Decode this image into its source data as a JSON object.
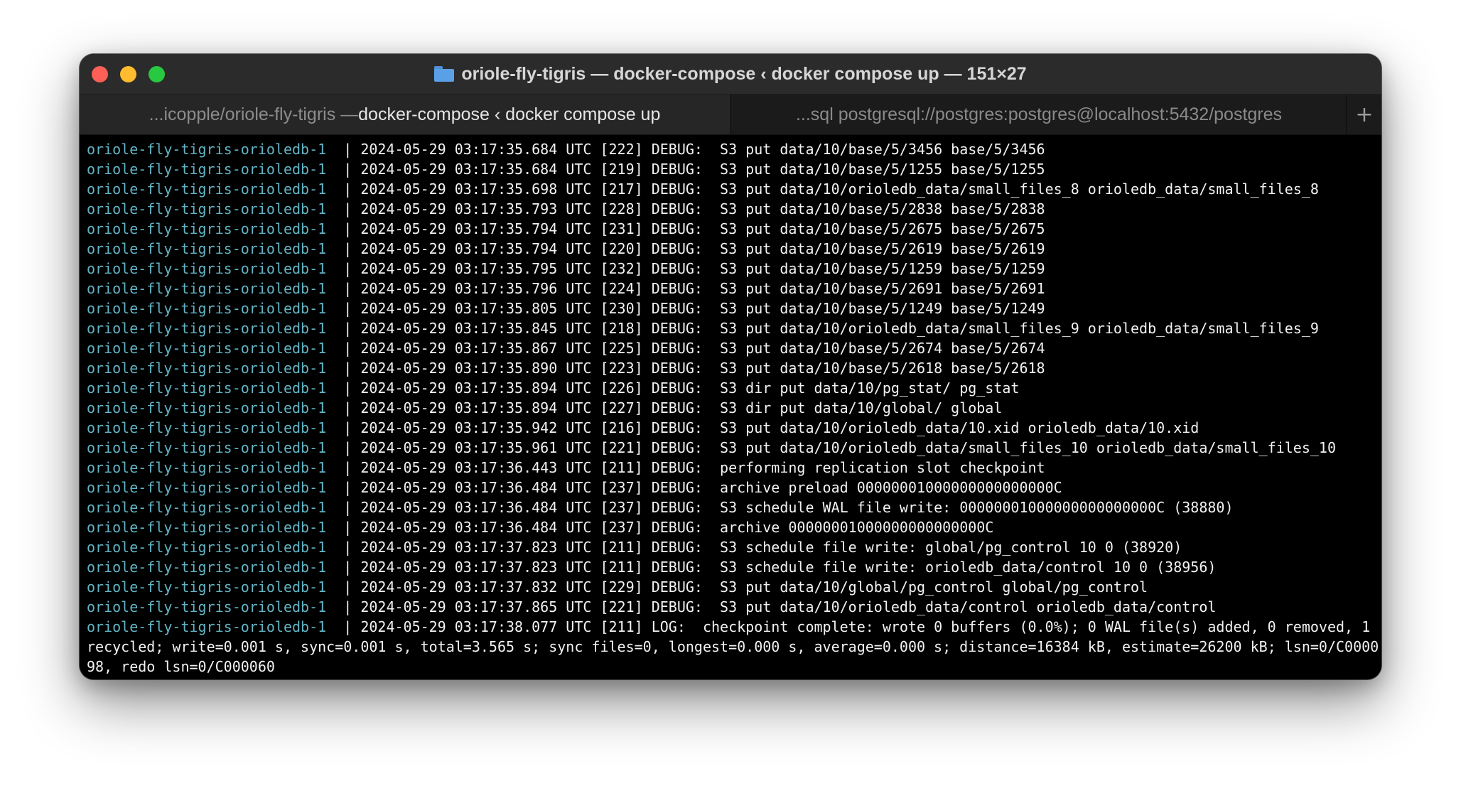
{
  "window": {
    "title": "oriole-fly-tigris — docker-compose ‹ docker compose up — 151×27",
    "title_icon": "folder-icon"
  },
  "tabs": [
    {
      "label_dim": "...icopple/oriole-fly-tigris — ",
      "label_bright": "docker-compose ‹ docker compose up",
      "active": true
    },
    {
      "label_dim": "...sql postgresql://postgres:postgres@localhost:5432/postgres",
      "label_bright": "",
      "active": false
    }
  ],
  "new_tab_label": "+",
  "colors": {
    "service_name": "#62b4c4",
    "log_text": "#f2f2f2",
    "background": "#000000"
  },
  "log_lines": [
    {
      "service": "oriole-fly-tigris-orioledb-1  ",
      "text": "| 2024-05-29 03:17:35.684 UTC [222] DEBUG:  S3 put data/10/base/5/3456 base/5/3456"
    },
    {
      "service": "oriole-fly-tigris-orioledb-1  ",
      "text": "| 2024-05-29 03:17:35.684 UTC [219] DEBUG:  S3 put data/10/base/5/1255 base/5/1255"
    },
    {
      "service": "oriole-fly-tigris-orioledb-1  ",
      "text": "| 2024-05-29 03:17:35.698 UTC [217] DEBUG:  S3 put data/10/orioledb_data/small_files_8 orioledb_data/small_files_8"
    },
    {
      "service": "oriole-fly-tigris-orioledb-1  ",
      "text": "| 2024-05-29 03:17:35.793 UTC [228] DEBUG:  S3 put data/10/base/5/2838 base/5/2838"
    },
    {
      "service": "oriole-fly-tigris-orioledb-1  ",
      "text": "| 2024-05-29 03:17:35.794 UTC [231] DEBUG:  S3 put data/10/base/5/2675 base/5/2675"
    },
    {
      "service": "oriole-fly-tigris-orioledb-1  ",
      "text": "| 2024-05-29 03:17:35.794 UTC [220] DEBUG:  S3 put data/10/base/5/2619 base/5/2619"
    },
    {
      "service": "oriole-fly-tigris-orioledb-1  ",
      "text": "| 2024-05-29 03:17:35.795 UTC [232] DEBUG:  S3 put data/10/base/5/1259 base/5/1259"
    },
    {
      "service": "oriole-fly-tigris-orioledb-1  ",
      "text": "| 2024-05-29 03:17:35.796 UTC [224] DEBUG:  S3 put data/10/base/5/2691 base/5/2691"
    },
    {
      "service": "oriole-fly-tigris-orioledb-1  ",
      "text": "| 2024-05-29 03:17:35.805 UTC [230] DEBUG:  S3 put data/10/base/5/1249 base/5/1249"
    },
    {
      "service": "oriole-fly-tigris-orioledb-1  ",
      "text": "| 2024-05-29 03:17:35.845 UTC [218] DEBUG:  S3 put data/10/orioledb_data/small_files_9 orioledb_data/small_files_9"
    },
    {
      "service": "oriole-fly-tigris-orioledb-1  ",
      "text": "| 2024-05-29 03:17:35.867 UTC [225] DEBUG:  S3 put data/10/base/5/2674 base/5/2674"
    },
    {
      "service": "oriole-fly-tigris-orioledb-1  ",
      "text": "| 2024-05-29 03:17:35.890 UTC [223] DEBUG:  S3 put data/10/base/5/2618 base/5/2618"
    },
    {
      "service": "oriole-fly-tigris-orioledb-1  ",
      "text": "| 2024-05-29 03:17:35.894 UTC [226] DEBUG:  S3 dir put data/10/pg_stat/ pg_stat"
    },
    {
      "service": "oriole-fly-tigris-orioledb-1  ",
      "text": "| 2024-05-29 03:17:35.894 UTC [227] DEBUG:  S3 dir put data/10/global/ global"
    },
    {
      "service": "oriole-fly-tigris-orioledb-1  ",
      "text": "| 2024-05-29 03:17:35.942 UTC [216] DEBUG:  S3 put data/10/orioledb_data/10.xid orioledb_data/10.xid"
    },
    {
      "service": "oriole-fly-tigris-orioledb-1  ",
      "text": "| 2024-05-29 03:17:35.961 UTC [221] DEBUG:  S3 put data/10/orioledb_data/small_files_10 orioledb_data/small_files_10"
    },
    {
      "service": "oriole-fly-tigris-orioledb-1  ",
      "text": "| 2024-05-29 03:17:36.443 UTC [211] DEBUG:  performing replication slot checkpoint"
    },
    {
      "service": "oriole-fly-tigris-orioledb-1  ",
      "text": "| 2024-05-29 03:17:36.484 UTC [237] DEBUG:  archive preload 00000001000000000000000C"
    },
    {
      "service": "oriole-fly-tigris-orioledb-1  ",
      "text": "| 2024-05-29 03:17:36.484 UTC [237] DEBUG:  S3 schedule WAL file write: 00000001000000000000000C (38880)"
    },
    {
      "service": "oriole-fly-tigris-orioledb-1  ",
      "text": "| 2024-05-29 03:17:36.484 UTC [237] DEBUG:  archive 00000001000000000000000C"
    },
    {
      "service": "oriole-fly-tigris-orioledb-1  ",
      "text": "| 2024-05-29 03:17:37.823 UTC [211] DEBUG:  S3 schedule file write: global/pg_control 10 0 (38920)"
    },
    {
      "service": "oriole-fly-tigris-orioledb-1  ",
      "text": "| 2024-05-29 03:17:37.823 UTC [211] DEBUG:  S3 schedule file write: orioledb_data/control 10 0 (38956)"
    },
    {
      "service": "oriole-fly-tigris-orioledb-1  ",
      "text": "| 2024-05-29 03:17:37.832 UTC [229] DEBUG:  S3 put data/10/global/pg_control global/pg_control"
    },
    {
      "service": "oriole-fly-tigris-orioledb-1  ",
      "text": "| 2024-05-29 03:17:37.865 UTC [221] DEBUG:  S3 put data/10/orioledb_data/control orioledb_data/control"
    },
    {
      "service": "oriole-fly-tigris-orioledb-1  ",
      "text": "| 2024-05-29 03:17:38.077 UTC [211] LOG:  checkpoint complete: wrote 0 buffers (0.0%); 0 WAL file(s) added, 0 removed, 1"
    },
    {
      "service": "",
      "text": "recycled; write=0.001 s, sync=0.001 s, total=3.565 s; sync files=0, longest=0.000 s, average=0.000 s; distance=16384 kB, estimate=26200 kB; lsn=0/C0000"
    },
    {
      "service": "",
      "text": "98, redo lsn=0/C000060"
    }
  ]
}
